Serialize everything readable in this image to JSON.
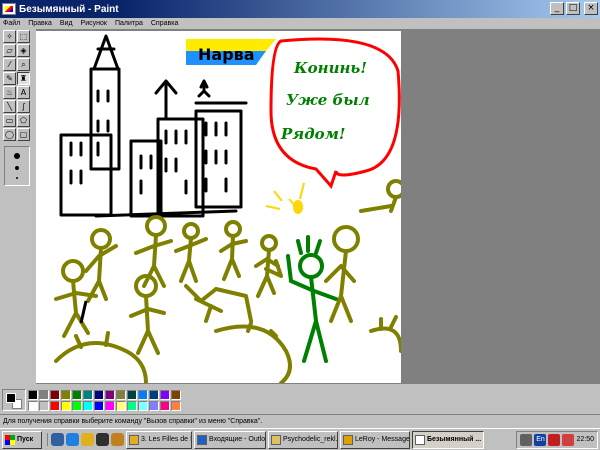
{
  "window": {
    "title": "Безымянный - Paint",
    "controls": {
      "minimize": "_",
      "maximize": "□",
      "close": "×"
    }
  },
  "menu": [
    "Файл",
    "Правка",
    "Вид",
    "Рисунок",
    "Палитра",
    "Справка"
  ],
  "tools": [
    {
      "icon": "free-select-icon",
      "glyph": "✧"
    },
    {
      "icon": "select-icon",
      "glyph": "⬚"
    },
    {
      "icon": "eraser-icon",
      "glyph": "▱"
    },
    {
      "icon": "fill-icon",
      "glyph": "◈"
    },
    {
      "icon": "color-picker-icon",
      "glyph": "⁄"
    },
    {
      "icon": "magnifier-icon",
      "glyph": "⌕"
    },
    {
      "icon": "pencil-icon",
      "glyph": "✎"
    },
    {
      "icon": "brush-icon",
      "glyph": "♜"
    },
    {
      "icon": "airbrush-icon",
      "glyph": "♨"
    },
    {
      "icon": "text-icon",
      "glyph": "A"
    },
    {
      "icon": "line-icon",
      "glyph": "╲"
    },
    {
      "icon": "curve-icon",
      "glyph": "∫"
    },
    {
      "icon": "rectangle-icon",
      "glyph": "▭"
    },
    {
      "icon": "polygon-icon",
      "glyph": "⬠"
    },
    {
      "icon": "ellipse-icon",
      "glyph": "◯"
    },
    {
      "icon": "rounded-rect-icon",
      "glyph": "▢"
    }
  ],
  "selected_tool": 7,
  "drawing_text": {
    "banner": "Нарва",
    "bubble_line1": "Конинь!",
    "bubble_line2": "Уже был",
    "bubble_line3": "Рядом!"
  },
  "palette": {
    "foreground": "#000000",
    "background": "#ffffff",
    "colors": [
      "#000000",
      "#808080",
      "#800000",
      "#808000",
      "#008000",
      "#008080",
      "#000080",
      "#800080",
      "#808040",
      "#004040",
      "#0080ff",
      "#004080",
      "#8000ff",
      "#804000",
      "#ffffff",
      "#c0c0c0",
      "#ff0000",
      "#ffff00",
      "#00ff00",
      "#00ffff",
      "#0000ff",
      "#ff00ff",
      "#ffff80",
      "#00ff80",
      "#80ffff",
      "#8080ff",
      "#ff0080",
      "#ff8040"
    ]
  },
  "status": "Для получения справки выберите команду \"Вызов справки\" из меню \"Справка\".",
  "taskbar": {
    "start_label": "Пуск",
    "quick_launch": [
      {
        "icon": "desktop-icon",
        "color": "#3060a0"
      },
      {
        "icon": "ie-icon",
        "color": "#2080e0"
      },
      {
        "icon": "outlook-icon",
        "color": "#e0b020"
      },
      {
        "icon": "winamp-icon",
        "color": "#303030"
      },
      {
        "icon": "explorer-icon",
        "color": "#c08020"
      }
    ],
    "tasks": [
      {
        "label": "3. Les Filles de S...",
        "icon": "winamp-icon",
        "color": "#e0b020"
      },
      {
        "label": "Входящие - Outlo...",
        "icon": "outlook-icon",
        "color": "#2060c0"
      },
      {
        "label": "Psychodelic_rekl...",
        "icon": "folder-icon",
        "color": "#e0c060"
      },
      {
        "label": "LeRoy - Message...",
        "icon": "messenger-icon",
        "color": "#e0a000"
      },
      {
        "label": "Безымянный ...",
        "icon": "paint-icon",
        "color": "#ffffff"
      }
    ],
    "tray": {
      "lang": "En",
      "clock": "22:50"
    }
  }
}
